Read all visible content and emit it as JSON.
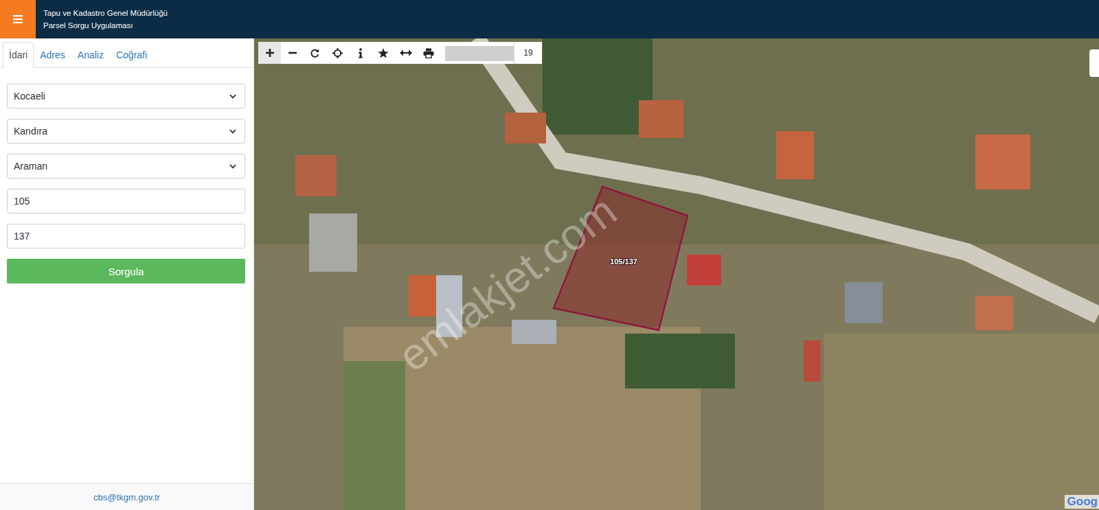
{
  "header": {
    "title": "Tapu ve Kadastro Genel Müdürlüğü",
    "subtitle": "Parsel Sorgu Uygulaması"
  },
  "tabs": [
    {
      "label": "İdari",
      "selected": true
    },
    {
      "label": "Adres",
      "selected": false
    },
    {
      "label": "Analiz",
      "selected": false
    },
    {
      "label": "Coğrafi",
      "selected": false
    }
  ],
  "form": {
    "fields": [
      {
        "kind": "select",
        "value": "Kocaeli"
      },
      {
        "kind": "select",
        "value": "Kandıra"
      },
      {
        "kind": "select",
        "value": "Araman"
      },
      {
        "kind": "input",
        "value": "105"
      },
      {
        "kind": "input",
        "value": "137"
      }
    ],
    "submit": "Sorgula"
  },
  "footer": "cbs@tkgm.gov.tr",
  "map": {
    "zoom": "19",
    "parcel_label": "105/137",
    "watermark": "emlakjet.com",
    "attribution": "Goog"
  }
}
